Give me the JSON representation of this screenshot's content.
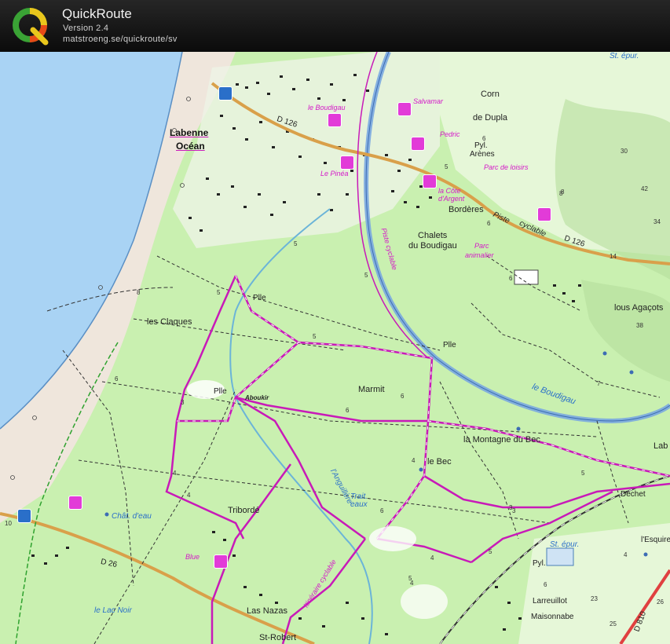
{
  "app": {
    "title": "QuickRoute",
    "version": "Version 2.4",
    "url": "matstroeng.se/quickroute/sv"
  },
  "map": {
    "place_labels": {
      "labenne": "Labenne",
      "ocean": "Océan",
      "corn": "Corn",
      "dupla": "de Dupla",
      "arenes": "Arènes",
      "pyl1": "Pyl.",
      "bordieres": "Bordères",
      "chalets1": "Chalets",
      "chalets2": "du Boudigau",
      "piste": "Piste",
      "cyclable": "cyclable",
      "d126_top": "D 126",
      "d126_right": "D 126",
      "claques": "les Claques",
      "plle1": "Plle",
      "plle2": "Plle",
      "plle3": "Plle",
      "aboukir": "Aboukir",
      "marmit": "Marmit",
      "montagne": "la Montagne du Bec",
      "lebec": "le Bec",
      "tribordé": "Tribordé",
      "agacots": "lous Agaçots",
      "deche": "Déchet",
      "esquire": "l'Esquire",
      "pyl2": "Pyl.",
      "larreuillot": "Larreuillot",
      "maisonnabe": "Maisonnabe",
      "d26": "D 26",
      "las_nazas": "Las Nazas",
      "st_robert": "St-Robert",
      "lab": "Lab",
      "d810": "D 810"
    },
    "magenta_labels": {
      "boudigau": "le Boudigau",
      "salvamar": "Salvamar",
      "pedric": "Pedric",
      "parc_loisirs": "Parc de loisirs",
      "cote_argent": "la Côte d'Argent",
      "parc_animalier1": "Parc",
      "parc_animalier2": "animalier",
      "piste_cyclable_v": "Piste cyclable",
      "blue": "Blue",
      "itin_cyclable": "Itinéraire cyclable",
      "pinea": "Le Pinéa"
    },
    "water_labels": {
      "boudigau_river": "le Boudigau",
      "anguillere": "l'Anguillère",
      "lac_noir": "le Lac Noir",
      "chat_eau": "Chât. d'eau",
      "st_epur_top": "St. épur.",
      "st_epur": "St. épur.",
      "trait_eaux": "Trait. eaux"
    },
    "colors": {
      "sea": "#a9d3f4",
      "beach": "#efe6dc",
      "forest": "#c9f0b0",
      "meadow": "#e6f7d8",
      "road": "#d9a04a",
      "route": "#c81ab8",
      "canal": "#7aa8e0"
    },
    "spot_heights": [
      "8",
      "5",
      "5",
      "6",
      "6",
      "6",
      "8",
      "5",
      "5",
      "6",
      "5",
      "3",
      "6",
      "4",
      "4",
      "3",
      "4",
      "6",
      "5",
      "4",
      "5",
      "6",
      "4",
      "5",
      "4",
      "6",
      "3",
      "7",
      "8",
      "14",
      "30",
      "42",
      "34",
      "38",
      "23",
      "25",
      "26",
      "10"
    ]
  }
}
